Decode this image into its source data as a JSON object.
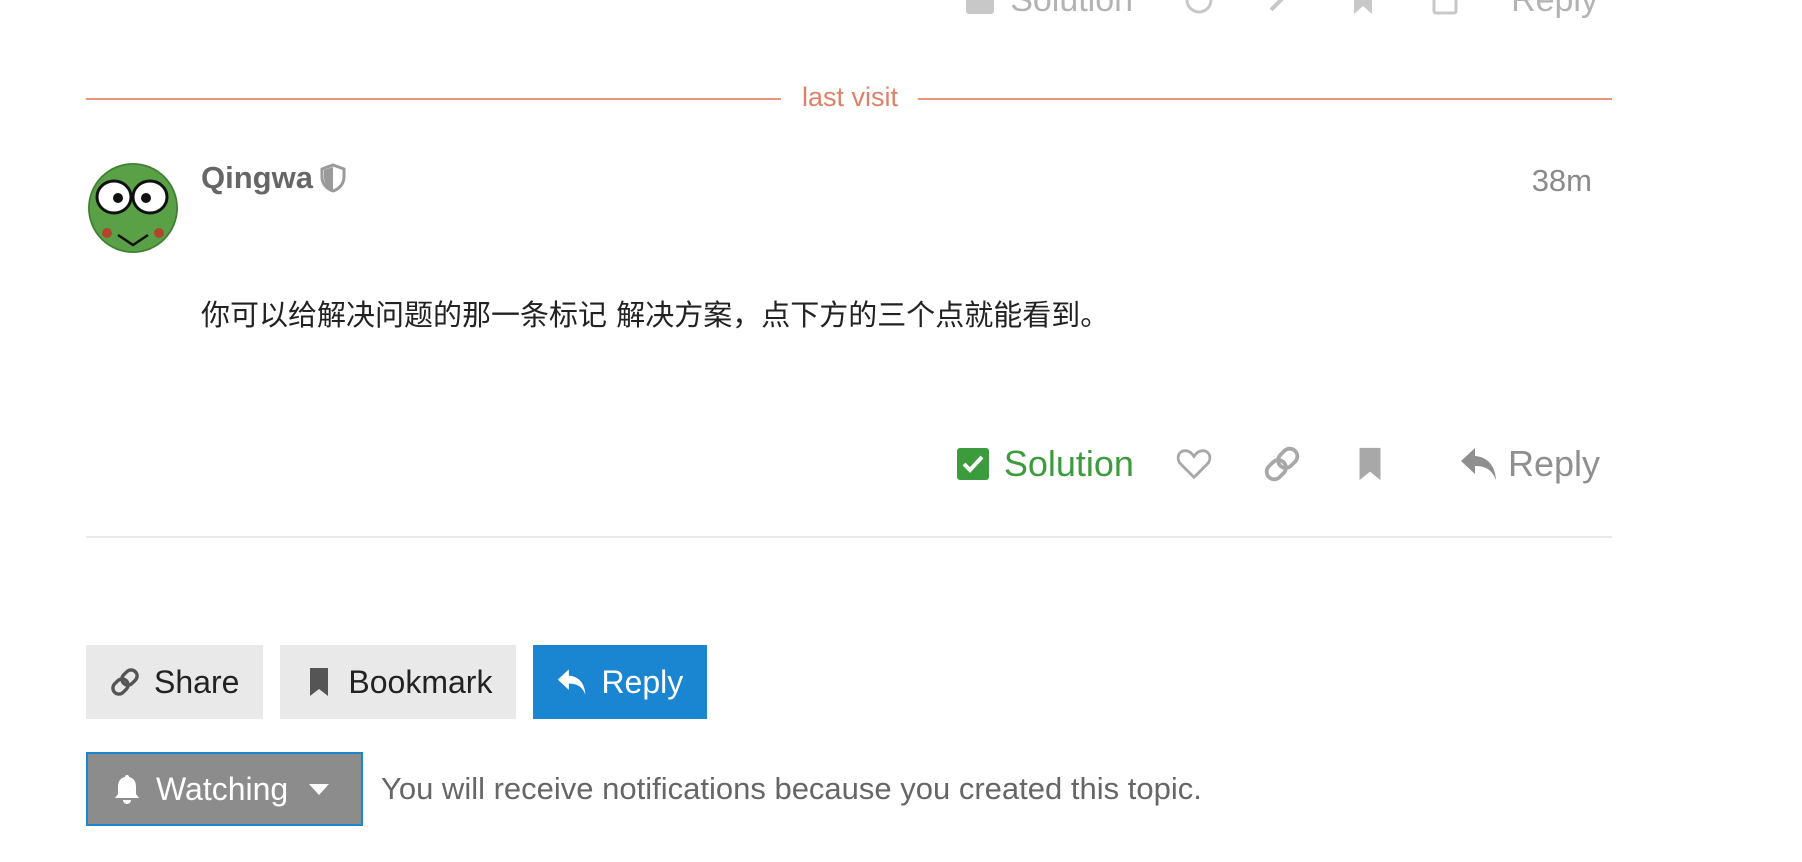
{
  "previous_post": {
    "solution_label": "Solution",
    "reply_label": "Reply"
  },
  "divider": {
    "label": "last visit",
    "color": "#e8947d"
  },
  "post": {
    "username": "Qingwa",
    "time": "38m",
    "body": "你可以给解决问题的那一条标记 解决方案，点下方的三个点就能看到。",
    "actions": {
      "solution_label": "Solution",
      "reply_label": "Reply"
    }
  },
  "footer": {
    "share_label": "Share",
    "bookmark_label": "Bookmark",
    "reply_label": "Reply",
    "watching_label": "Watching",
    "notification_text": "You will receive notifications because you created this topic."
  },
  "colors": {
    "solution_green": "#3c9b3c",
    "primary_blue": "#1a85d1",
    "watching_grey": "#8c8c8c"
  },
  "icons": [
    "check-square-icon",
    "heart-icon",
    "link-icon",
    "bookmark-icon",
    "reply-icon",
    "shield-icon",
    "bell-icon",
    "caret-down-icon"
  ]
}
